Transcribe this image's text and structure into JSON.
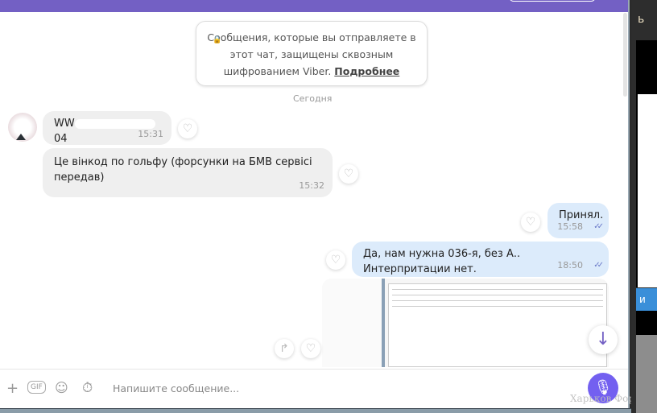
{
  "notice": {
    "text": "Сообщения, которые вы отправляете в этот чат, защищены сквозным шифрованием Viber.",
    "link": "Подробнее"
  },
  "date_separator": "Сегодня",
  "messages": [
    {
      "dir": "in",
      "text_start": "WW",
      "text_end": "04",
      "time": "15:31"
    },
    {
      "dir": "in",
      "text": "Це вінкод по гольфу (форсунки на БМВ сервісі передав)",
      "time": "15:32"
    },
    {
      "dir": "out",
      "text": "Принял.",
      "time": "15:58",
      "status": "read"
    },
    {
      "dir": "out",
      "text": "Да, нам нужна 036-я, без А.. Интерпритации нет.",
      "time": "18:50",
      "status": "read"
    }
  ],
  "composer": {
    "placeholder": "Напишите сообщение..."
  },
  "watermark": "Харьков Форум",
  "side_button": "и",
  "colors": {
    "accent": "#7360c4",
    "outgoing": "#dcebfb",
    "incoming": "#efefef"
  }
}
